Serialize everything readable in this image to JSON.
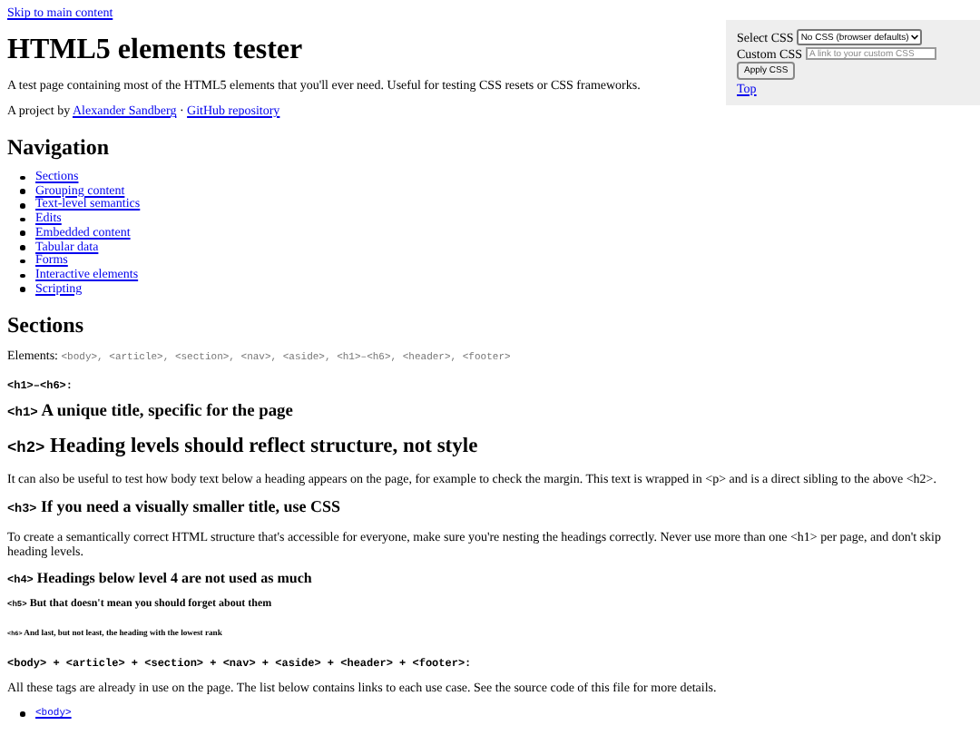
{
  "skip_link": "Skip to main content",
  "header": {
    "title": "HTML5 elements tester",
    "description": "A test page containing most of the HTML5 elements that you'll ever need. Useful for testing CSS resets or CSS frameworks.",
    "byline": {
      "prefix": "A project by",
      "author": "Alexander Sandberg",
      "separator": "·",
      "repo": "GitHub repository"
    }
  },
  "css_panel": {
    "select_label": "Select CSS",
    "select_value": "No CSS (browser defaults)",
    "custom_label": "Custom CSS",
    "custom_placeholder": "A link to your custom CSS",
    "apply_button": "Apply CSS",
    "top_link": "Top"
  },
  "navigation": {
    "heading": "Navigation",
    "items": [
      "Sections",
      "Grouping content",
      "Text-level semantics",
      "Edits",
      "Embedded content",
      "Tabular data",
      "Forms",
      "Interactive elements",
      "Scripting"
    ]
  },
  "sections": {
    "heading": "Sections",
    "elements_label": "Elements:",
    "elements_code": "<body>, <article>, <section>, <nav>, <aside>, <h1>–<h6>, <header>, <footer>",
    "headings_title": "<h1>–<h6>:",
    "blocks": [
      {
        "kind": "h1",
        "tag": "<h1>",
        "text": "A unique title, specific for the page"
      },
      {
        "kind": "h2",
        "tag": "<h2>",
        "text": "Heading levels should reflect structure, not style"
      },
      {
        "kind": "paragraph",
        "text": "It can also be useful to test how body text below a heading appears on the page, for example to check the margin. This text is wrapped in <p> and is a direct sibling to the above <h2>."
      },
      {
        "kind": "h3",
        "tag": "<h3>",
        "text": "If you need a visually smaller title, use CSS"
      },
      {
        "kind": "paragraph",
        "text": "To create a semantically correct HTML structure that's accessible for everyone, make sure you're nesting the headings correctly. Never use more than one <h1> per page, and don't skip heading levels."
      },
      {
        "kind": "h4",
        "tag": "<h4>",
        "text": "Headings below level 4 are not used as much"
      },
      {
        "kind": "h5",
        "tag": "<h5>",
        "text": "But that doesn't mean you should forget about them"
      },
      {
        "kind": "h6",
        "tag": "<h6>",
        "text": "And last, but not least, the heading with the lowest rank"
      }
    ],
    "layout_title": "<body> + <article> + <section> + <nav> + <aside> + <header> + <footer>:",
    "layout_text": "All these tags are already in use on the page. The list below contains links to each use case. See the source code of this file for more details.",
    "layout_links": [
      "<body>"
    ]
  }
}
